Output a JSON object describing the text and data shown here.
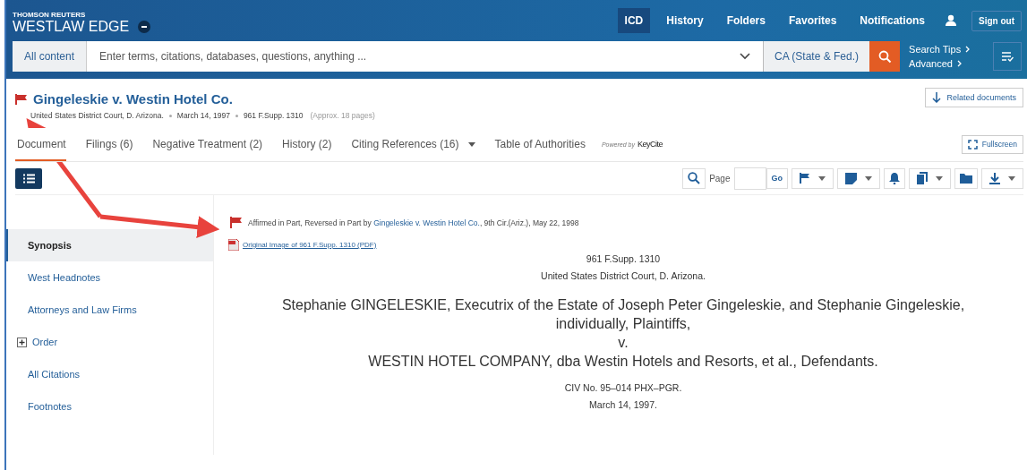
{
  "brand": {
    "company": "THOMSON REUTERS",
    "product": "WESTLAW EDGE"
  },
  "nav": [
    {
      "label": "ICD",
      "selected": true
    },
    {
      "label": "History",
      "selected": false
    },
    {
      "label": "Folders",
      "selected": false
    },
    {
      "label": "Favorites",
      "selected": false
    },
    {
      "label": "Notifications",
      "selected": false
    }
  ],
  "sign_out": "Sign out",
  "search": {
    "scope": "All content",
    "placeholder": "Enter terms, citations, databases, questions, anything ...",
    "jurisdiction": "CA (State & Fed.)",
    "links": [
      "Search Tips",
      "Advanced"
    ]
  },
  "document_header": {
    "title": "Gingeleskie v. Westin Hotel Co.",
    "meta": [
      "United States District Court, D. Arizona.",
      "March 14, 1997",
      "961 F.Supp. 1310"
    ],
    "pages": "(Approx. 18 pages)",
    "related": "Related documents",
    "fullscreen": "Fullscreen"
  },
  "tabs": [
    {
      "label": "Document",
      "selected": true,
      "dropdown": false
    },
    {
      "label": "Filings (6)",
      "selected": false,
      "dropdown": false
    },
    {
      "label": "Negative Treatment (2)",
      "selected": false,
      "dropdown": false
    },
    {
      "label": "History (2)",
      "selected": false,
      "dropdown": false
    },
    {
      "label": "Citing References (16)",
      "selected": false,
      "dropdown": true
    },
    {
      "label": "Table of Authorities",
      "selected": false,
      "dropdown": false
    }
  ],
  "powered_by": {
    "label": "Powered by",
    "brand": "KeyCite"
  },
  "toolbar": {
    "page_label": "Page",
    "go": "Go"
  },
  "sidebar": {
    "items": [
      {
        "label": "Synopsis",
        "selected": true
      },
      {
        "label": "West Headnotes",
        "selected": false
      },
      {
        "label": "Attorneys and Law Firms",
        "selected": false
      },
      {
        "label": "Order",
        "selected": false,
        "expanded": false
      },
      {
        "label": "All Citations",
        "selected": false
      },
      {
        "label": "Footnotes",
        "selected": false
      }
    ]
  },
  "document": {
    "history": {
      "before": "Affirmed in Part, Reversed in Part by ",
      "link": "Gingeleskie v. Westin Hotel Co.",
      "after": ", 9th Cir.(Ariz.), May 22, 1998"
    },
    "pdf_link": "Original Image of 961 F.Supp. 1310 (PDF)",
    "citation": "961 F.Supp. 1310",
    "court": "United States District Court, D. Arizona.",
    "plaintiffs": "Stephanie GINGELESKIE, Executrix of the Estate of Joseph Peter Gingeleskie, and Stephanie Gingeleskie, individually, Plaintiffs,",
    "versus": "v.",
    "defendants": "WESTIN HOTEL COMPANY, dba Westin Hotels and Resorts, et al., Defendants.",
    "docket": "CIV No. 95–014 PHX–PGR.",
    "date": "March 14, 1997."
  }
}
